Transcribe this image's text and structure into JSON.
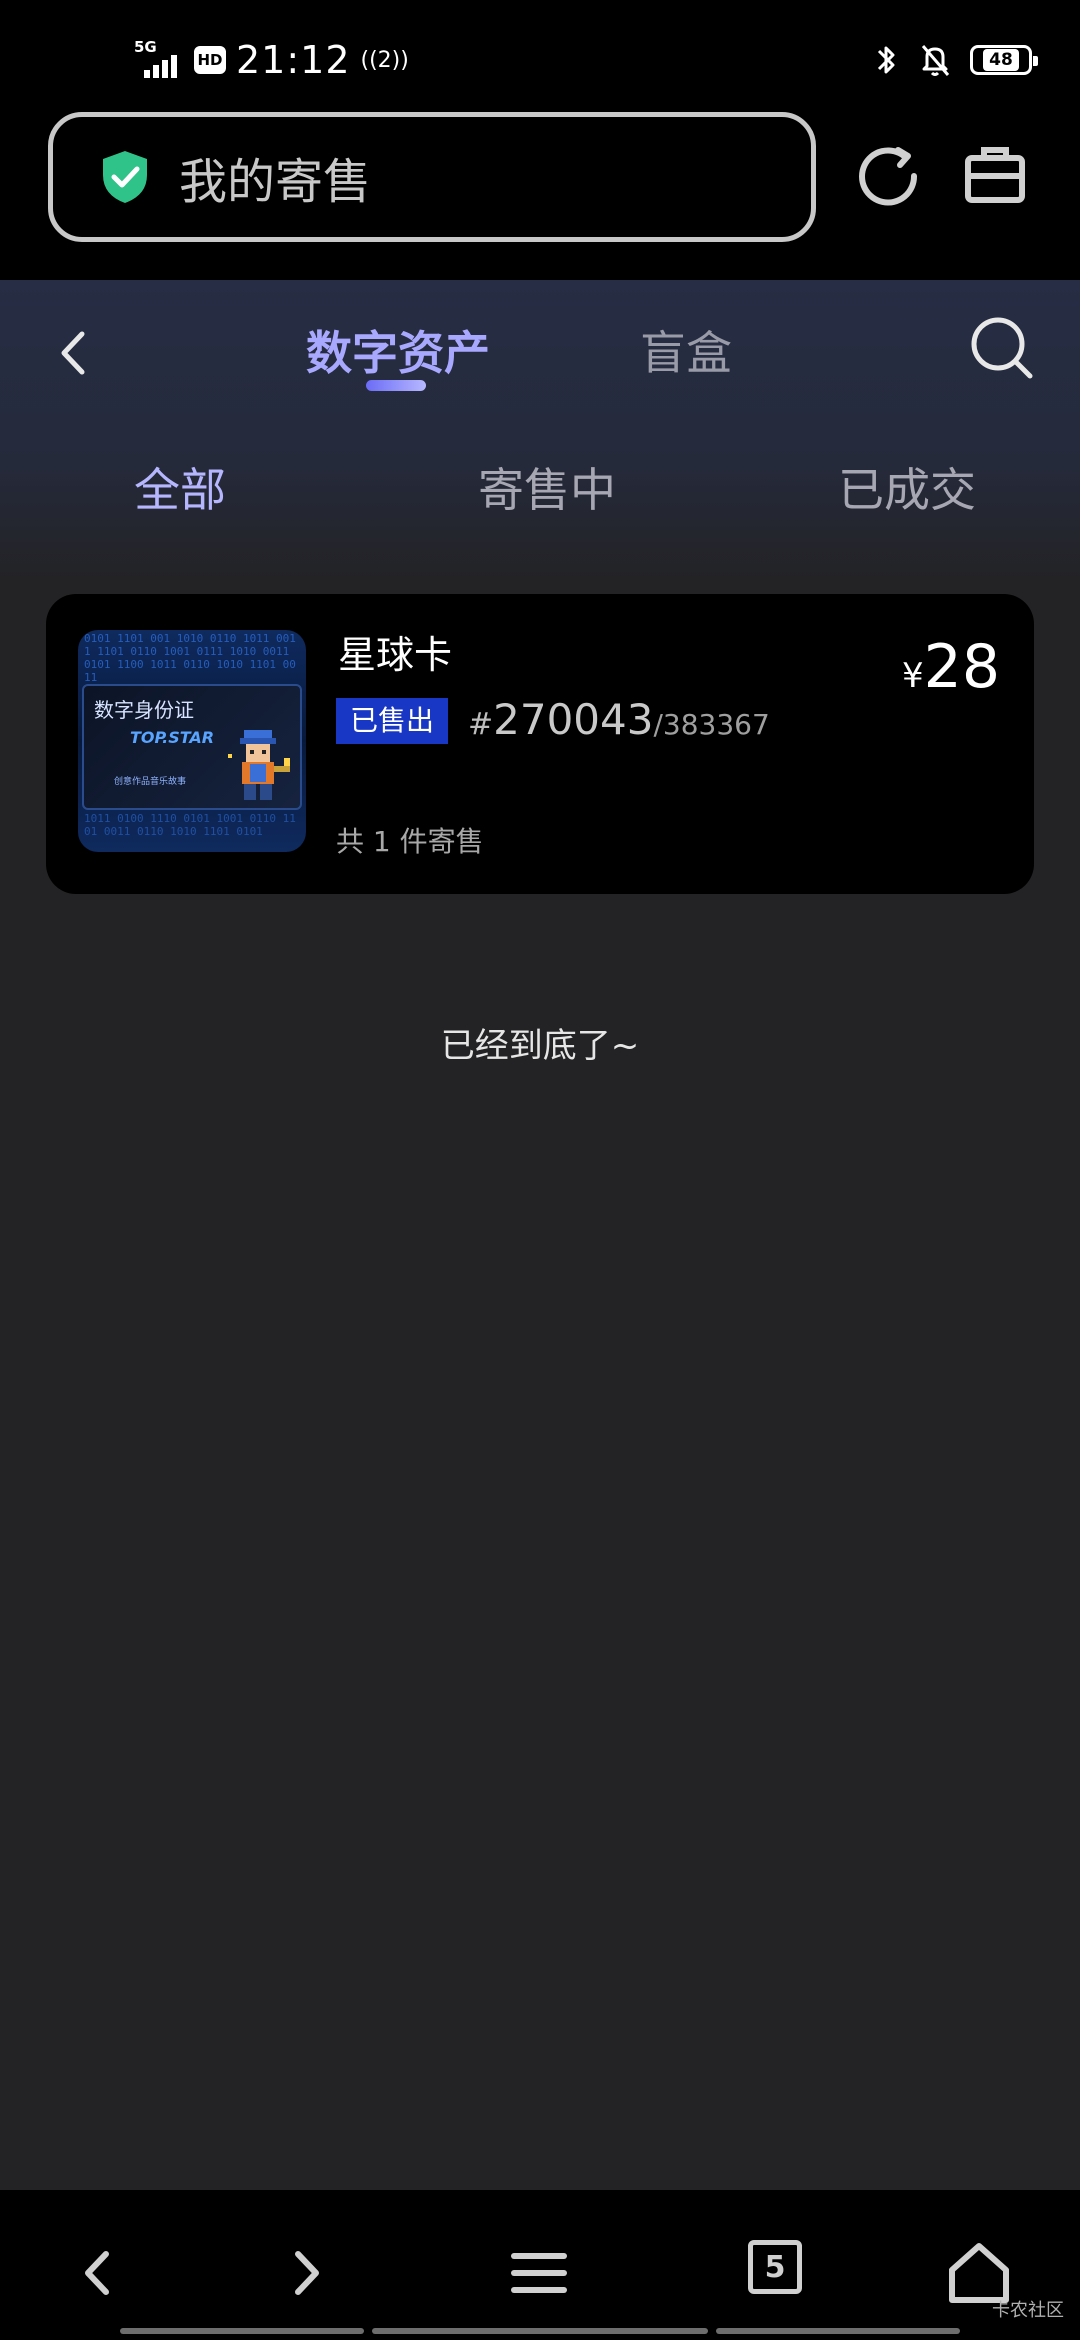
{
  "status_bar": {
    "network": "5G",
    "hd_label": "HD",
    "time": "21:12",
    "hotspot": "((2))",
    "battery": "48"
  },
  "browser": {
    "address_text": "我的寄售",
    "secure": true
  },
  "nav": {
    "tabs": [
      {
        "label": "数字资产",
        "active": true
      },
      {
        "label": "盲盒",
        "active": false
      }
    ]
  },
  "filter_tabs": [
    {
      "label": "全部",
      "active": true
    },
    {
      "label": "寄售中",
      "active": false
    },
    {
      "label": "已成交",
      "active": false
    }
  ],
  "listing": {
    "name": "星球卡",
    "status": "已售出",
    "serial_prefix": "#",
    "serial_number": "270043",
    "serial_total": "/383367",
    "currency": "¥",
    "price": "28",
    "count_text": "共 1 件寄售",
    "thumbnail": {
      "title": "数字身份证",
      "brand": "TOP.STAR",
      "caption": "创意作品音乐故事"
    }
  },
  "end_text": "已经到底了~",
  "bottom_bar": {
    "tab_count": "5"
  },
  "watermark": "卡农社区",
  "colors": {
    "accent": "#a9a8ff",
    "badge": "#1837c5",
    "background": "#232326",
    "card": "#000000",
    "shield": "#2fc38a"
  }
}
